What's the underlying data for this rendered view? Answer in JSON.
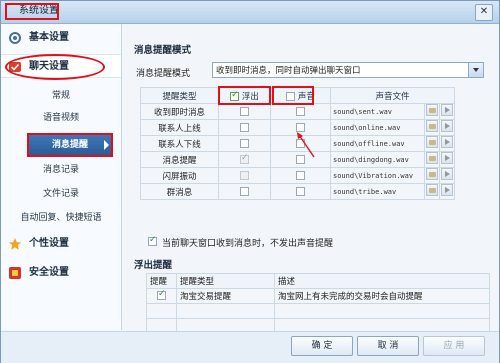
{
  "window": {
    "title": "系统设置",
    "close_glyph": "✕"
  },
  "sidebar": {
    "categories": [
      {
        "label": "基本设置",
        "icon": "gear-icon"
      },
      {
        "label": "聊天设置",
        "icon": "chat-check-icon"
      },
      {
        "label": "个性设置",
        "icon": "star-icon"
      },
      {
        "label": "安全设置",
        "icon": "shield-icon"
      }
    ],
    "sub_items": [
      "常规",
      "语音视频",
      "消息提醒",
      "消息记录",
      "文件记录",
      "自动回复、快捷短语"
    ],
    "active_sub": "消息提醒"
  },
  "content": {
    "section1_title": "消息提醒模式",
    "mode_label": "消息提醒模式",
    "mode_value": "收到即时消息，同时自动弹出聊天窗口",
    "table": {
      "headers": [
        "提醒类型",
        "浮出",
        "声音",
        "声音文件"
      ],
      "rows": [
        {
          "type": "收到即时消息",
          "float": false,
          "float_disabled": false,
          "sound": false,
          "file": "sound\\sent.wav"
        },
        {
          "type": "联系人上线",
          "float": false,
          "float_disabled": false,
          "sound": false,
          "file": "sound\\online.wav"
        },
        {
          "type": "联系人下线",
          "float": false,
          "float_disabled": false,
          "sound": false,
          "file": "sound\\offline.wav"
        },
        {
          "type": "消息提醒",
          "float": true,
          "float_disabled": true,
          "sound": false,
          "file": "sound\\dingdong.wav"
        },
        {
          "type": "闪屏振动",
          "float": false,
          "float_disabled": true,
          "sound": false,
          "file": "sound\\Vibration.wav"
        },
        {
          "type": "群消息",
          "float": false,
          "float_disabled": false,
          "sound": false,
          "file": "sound\\tribe.wav"
        }
      ]
    },
    "no_sound_checkbox": {
      "label": "当前聊天窗口收到消息时，不发出声音提醒",
      "checked": true
    },
    "section2_title": "浮出提醒",
    "list": {
      "headers": [
        "提醒",
        "提醒类型",
        "描述"
      ],
      "rows": [
        {
          "checked": true,
          "type": "淘宝交易提醒",
          "desc": "淘宝网上有未完成的交易时会自动提醒"
        }
      ]
    }
  },
  "footer": {
    "ok": "确 定",
    "cancel": "取 消",
    "apply": "应 用"
  },
  "colors": {
    "highlight": "#e0101a",
    "active_bg": "#3f77b7"
  }
}
